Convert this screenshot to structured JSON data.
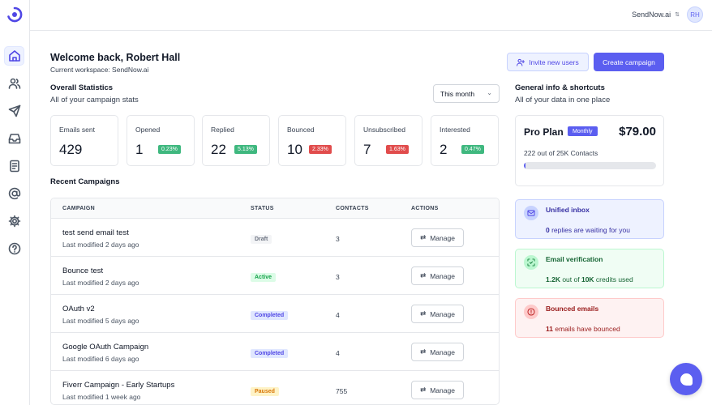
{
  "topbar": {
    "workspace": "SendNow.ai",
    "avatar_initials": "RH"
  },
  "header": {
    "welcome": "Welcome back, Robert Hall",
    "workspace_line": "Current workspace: SendNow.ai",
    "invite_label": "Invite new users",
    "create_label": "Create campaign"
  },
  "stats_section": {
    "title": "Overall Statistics",
    "subtitle": "All of your campaign stats",
    "period": "This month"
  },
  "stats": [
    {
      "label": "Emails sent",
      "value": "429",
      "percent": ""
    },
    {
      "label": "Opened",
      "value": "1",
      "percent": "0.23%"
    },
    {
      "label": "Replied",
      "value": "22",
      "percent": "5.13%"
    },
    {
      "label": "Bounced",
      "value": "10",
      "percent": "2.33%"
    },
    {
      "label": "Unsubscribed",
      "value": "7",
      "percent": "1.63%"
    },
    {
      "label": "Interested",
      "value": "2",
      "percent": "0.47%"
    }
  ],
  "campaigns": {
    "title": "Recent Campaigns",
    "columns": [
      "CAMPAIGN",
      "STATUS",
      "CONTACTS",
      "ACTIONS"
    ],
    "manage_label": "Manage",
    "rows": [
      {
        "name": "test send email test",
        "modified": "Last modified 2 days ago",
        "status": "Draft",
        "contacts": "3"
      },
      {
        "name": "Bounce test",
        "modified": "Last modified 2 days ago",
        "status": "Active",
        "contacts": "3"
      },
      {
        "name": "OAuth v2",
        "modified": "Last modified 5 days ago",
        "status": "Completed",
        "contacts": "4"
      },
      {
        "name": "Google OAuth Campaign",
        "modified": "Last modified 6 days ago",
        "status": "Completed",
        "contacts": "4"
      },
      {
        "name": "Fiverr Campaign - Early Startups",
        "modified": "Last modified 1 week ago",
        "status": "Paused",
        "contacts": "755"
      }
    ]
  },
  "general": {
    "title": "General info & shortcuts",
    "subtitle": "All of your data in one place"
  },
  "plan": {
    "name": "Pro Plan",
    "badge": "Monthly",
    "price": "$79.00",
    "contacts": "222 out of 25K Contacts",
    "usage_fraction": 0.0089
  },
  "shortcuts": {
    "inbox": {
      "title": "Unified inbox",
      "count": "0",
      "text": " replies are waiting for you"
    },
    "verify": {
      "title": "Email verification",
      "used": "1.2K",
      "mid": " out of ",
      "total": "10K",
      "text": " credits used"
    },
    "bounced": {
      "title": "Bounced emails",
      "count": "11",
      "text": " emails have bounced"
    }
  },
  "colors": {
    "accent": "#5b5ef0",
    "success": "#3fb87f",
    "danger": "#e14c4c"
  }
}
